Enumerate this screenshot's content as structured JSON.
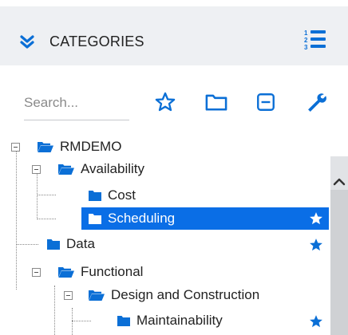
{
  "header": {
    "title": "CATEGORIES",
    "collapse_icon": "double-chevron-down-icon",
    "list_icon": "numbered-list-icon"
  },
  "toolbar": {
    "search_placeholder": "Search...",
    "icons": [
      "star-outline-icon",
      "folder-outline-icon",
      "collapse-box-icon",
      "wrench-icon"
    ]
  },
  "tree": {
    "root": "RMDEMO",
    "items": [
      {
        "label": "Availability"
      },
      {
        "label": "Cost"
      },
      {
        "label": "Scheduling",
        "selected": true,
        "starred": true
      },
      {
        "label": "Data",
        "starred": true
      },
      {
        "label": "Functional"
      },
      {
        "label": "Design and Construction"
      },
      {
        "label": "Maintainability",
        "starred": true
      }
    ]
  },
  "colors": {
    "accent": "#0a6ee6",
    "header_bg": "#eef0f3",
    "folder": "#0b6fd6"
  }
}
